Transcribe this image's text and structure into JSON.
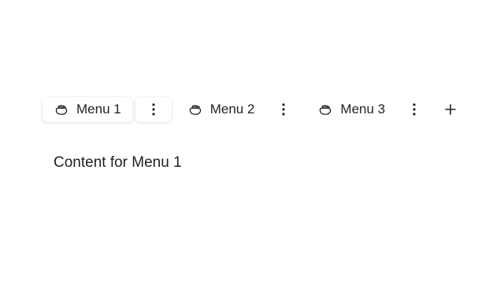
{
  "tabs": [
    {
      "label": "Menu 1",
      "icon": "grab-hand-icon",
      "active": true
    },
    {
      "label": "Menu 2",
      "icon": "grab-hand-icon",
      "active": false
    },
    {
      "label": "Menu 3",
      "icon": "grab-hand-icon",
      "active": false
    }
  ],
  "add_tab_icon": "plus-icon",
  "more_options_icon": "vertical-dots-icon",
  "content": {
    "text": "Content for Menu 1"
  },
  "colors": {
    "text": "#222222",
    "background": "#ffffff"
  }
}
